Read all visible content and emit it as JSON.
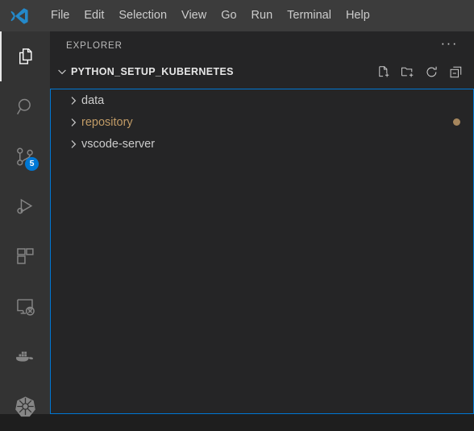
{
  "window": {
    "logo_name": "vscode-logo"
  },
  "menubar": {
    "items": [
      {
        "label": "File",
        "name": "menu-file"
      },
      {
        "label": "Edit",
        "name": "menu-edit"
      },
      {
        "label": "Selection",
        "name": "menu-selection"
      },
      {
        "label": "View",
        "name": "menu-view"
      },
      {
        "label": "Go",
        "name": "menu-go"
      },
      {
        "label": "Run",
        "name": "menu-run"
      },
      {
        "label": "Terminal",
        "name": "menu-terminal"
      },
      {
        "label": "Help",
        "name": "menu-help"
      }
    ]
  },
  "activity_bar": {
    "items": [
      {
        "icon": "files-explorer-icon",
        "title": "Explorer",
        "active": true,
        "badge": null
      },
      {
        "icon": "search-icon",
        "title": "Search",
        "active": false,
        "badge": null
      },
      {
        "icon": "source-control-icon",
        "title": "Source Control",
        "active": false,
        "badge": "5"
      },
      {
        "icon": "run-and-debug-icon",
        "title": "Run and Debug",
        "active": false,
        "badge": null
      },
      {
        "icon": "extensions-icon",
        "title": "Extensions",
        "active": false,
        "badge": null
      },
      {
        "icon": "remote-explorer-icon",
        "title": "Remote Explorer",
        "active": false,
        "badge": null
      },
      {
        "icon": "docker-whale-icon",
        "title": "Docker",
        "active": false,
        "badge": null
      },
      {
        "icon": "kubernetes-helm-icon",
        "title": "Kubernetes",
        "active": false,
        "badge": null
      }
    ]
  },
  "sidebar": {
    "title": "EXPLORER",
    "more_actions_label": "···",
    "section": {
      "title": "PYTHON_SETUP_KUBERNETES",
      "expanded": true,
      "actions": [
        {
          "name": "new-file-button",
          "icon": "new-file-icon",
          "title": "New File..."
        },
        {
          "name": "new-folder-button",
          "icon": "new-folder-icon",
          "title": "New Folder..."
        },
        {
          "name": "refresh-explorer-button",
          "icon": "refresh-icon",
          "title": "Refresh Explorer"
        },
        {
          "name": "collapse-folders-button",
          "icon": "collapse-all-icon",
          "title": "Collapse Folders in Explorer"
        }
      ]
    },
    "tree": {
      "items": [
        {
          "label": "data",
          "expanded": false,
          "modified": false,
          "dot": false
        },
        {
          "label": "repository",
          "expanded": false,
          "modified": true,
          "dot": true
        },
        {
          "label": "vscode-server",
          "expanded": false,
          "modified": false,
          "dot": false
        }
      ]
    }
  },
  "colors": {
    "titlebar_bg": "#3c3c3c",
    "activitybar_bg": "#333333",
    "sidebar_bg": "#252526",
    "focus_border": "#0078d4",
    "badge_bg": "#0078d4",
    "text": "#cccccc",
    "modified_text": "#c19b66",
    "logo_blue": "#2489ca"
  }
}
